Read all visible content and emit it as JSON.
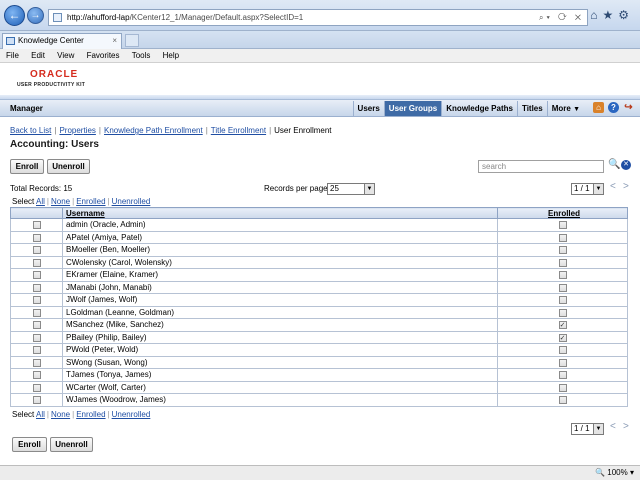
{
  "browser": {
    "url_host": "http://ahufford-lap",
    "url_path": "/KCenter12_1/Manager/Default.aspx?SelectID=1",
    "tab_title": "Knowledge Center",
    "menu": [
      "File",
      "Edit",
      "View",
      "Favorites",
      "Tools",
      "Help"
    ],
    "zoom": "100%"
  },
  "brand": {
    "logo": "ORACLE",
    "product": "USER PRODUCTIVITY KIT"
  },
  "app": {
    "title": "Manager",
    "nav": [
      {
        "label": "Users"
      },
      {
        "label": "User Groups"
      },
      {
        "label": "Knowledge Paths"
      },
      {
        "label": "Titles"
      },
      {
        "label": "More"
      }
    ]
  },
  "breadcrumb": {
    "back": "Back to List",
    "properties": "Properties",
    "kp_enrollment": "Knowledge Path Enrollment",
    "title_enrollment": "Title Enrollment",
    "current": "User Enrollment"
  },
  "heading": "Accounting: Users",
  "actions": {
    "enroll": "Enroll",
    "unenroll": "Unenroll"
  },
  "search": {
    "placeholder": "search"
  },
  "listinfo": {
    "total": "Total Records: 15",
    "per_page_label": "Records per page:",
    "per_page_value": "25",
    "page": "1 / 1"
  },
  "select": {
    "label": "Select",
    "all": "All",
    "none": "None",
    "enrolled": "Enrolled",
    "unenrolled": "Unenrolled"
  },
  "table": {
    "col_username": "Username",
    "col_enrolled": "Enrolled",
    "rows": [
      {
        "username": "admin (Oracle, Admin)",
        "enrolled": false
      },
      {
        "username": "APatel (Amiya, Patel)",
        "enrolled": false
      },
      {
        "username": "BMoeller (Ben, Moeller)",
        "enrolled": false
      },
      {
        "username": "CWolensky (Carol, Wolensky)",
        "enrolled": false
      },
      {
        "username": "EKramer (Elaine, Kramer)",
        "enrolled": false
      },
      {
        "username": "JManabi (John, Manabi)",
        "enrolled": false
      },
      {
        "username": "JWolf (James, Wolf)",
        "enrolled": false
      },
      {
        "username": "LGoldman (Leanne, Goldman)",
        "enrolled": false
      },
      {
        "username": "MSanchez (Mike, Sanchez)",
        "enrolled": true
      },
      {
        "username": "PBailey (Philip, Bailey)",
        "enrolled": true
      },
      {
        "username": "PWold (Peter, Wold)",
        "enrolled": false
      },
      {
        "username": "SWong (Susan, Wong)",
        "enrolled": false
      },
      {
        "username": "TJames (Tonya, James)",
        "enrolled": false
      },
      {
        "username": "WCarter (Wolf, Carter)",
        "enrolled": false
      },
      {
        "username": "WJames (Woodrow, James)",
        "enrolled": false
      }
    ]
  }
}
